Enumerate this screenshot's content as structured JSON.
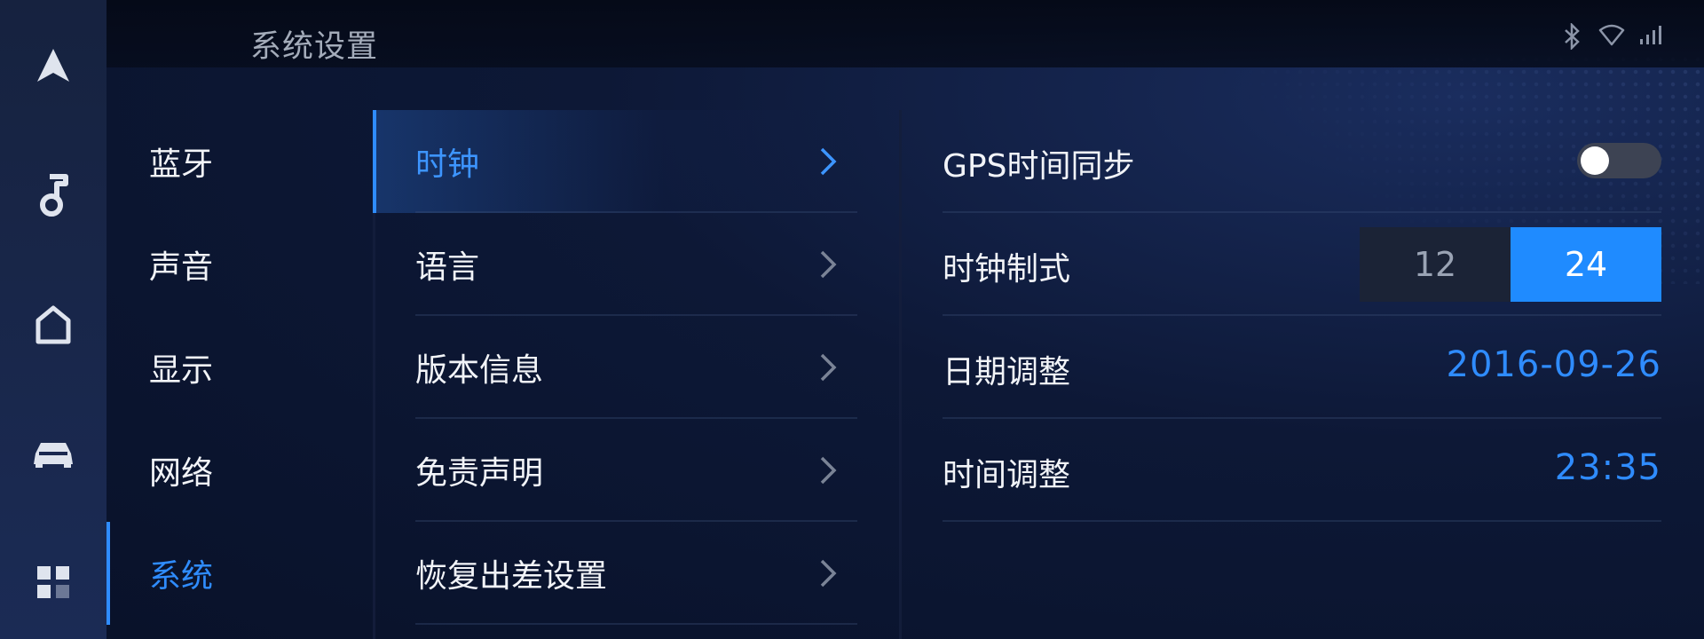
{
  "header": {
    "title": "系统设置"
  },
  "menu1": {
    "items": [
      {
        "label": "蓝牙"
      },
      {
        "label": "声音"
      },
      {
        "label": "显示"
      },
      {
        "label": "网络"
      },
      {
        "label": "系统"
      }
    ],
    "active_label": "系统"
  },
  "menu2": {
    "items": [
      {
        "label": "时钟"
      },
      {
        "label": "语言"
      },
      {
        "label": "版本信息"
      },
      {
        "label": "免责声明"
      },
      {
        "label": "恢复出差设置"
      }
    ],
    "active_label": "时钟"
  },
  "clock": {
    "gps_sync_label": "GPS时间同步",
    "gps_sync_enabled": false,
    "format_label": "时钟制式",
    "format_options": [
      "12",
      "24"
    ],
    "format_selected": "24",
    "date_label": "日期调整",
    "date_value": "2016-09-26",
    "time_label": "时间调整",
    "time_value": "23:35"
  },
  "colors": {
    "accent": "#2f8cff",
    "background": "#0a1228",
    "rail": "#16223f"
  },
  "icons": {
    "rail": [
      "navigation-icon",
      "music-icon",
      "home-icon",
      "car-icon",
      "apps-icon"
    ],
    "status": [
      "bluetooth-icon",
      "wifi-icon",
      "signal-icon"
    ]
  }
}
